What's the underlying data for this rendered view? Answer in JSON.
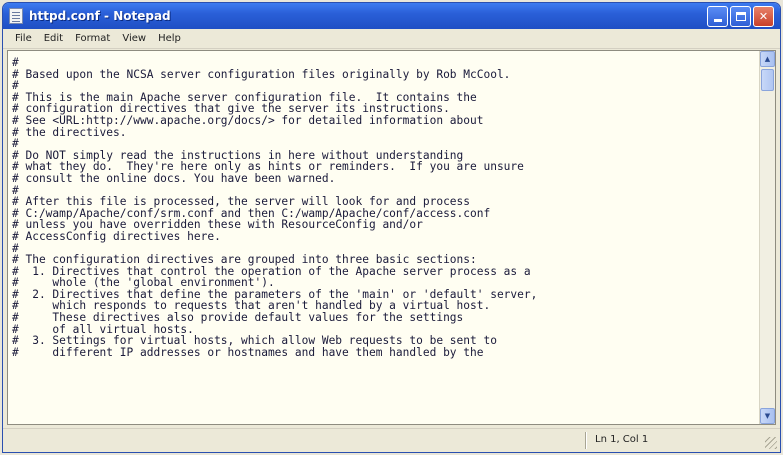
{
  "window": {
    "title": "httpd.conf - Notepad",
    "controls": {
      "minimize": "minimize",
      "maximize": "maximize",
      "close": "✕"
    }
  },
  "menu": {
    "items": [
      "File",
      "Edit",
      "Format",
      "View",
      "Help"
    ]
  },
  "editor": {
    "lines": [
      "#",
      "# Based upon the NCSA server configuration files originally by Rob McCool.",
      "#",
      "# This is the main Apache server configuration file.  It contains the",
      "# configuration directives that give the server its instructions.",
      "# See <URL:http://www.apache.org/docs/> for detailed information about",
      "# the directives.",
      "#",
      "# Do NOT simply read the instructions in here without understanding",
      "# what they do.  They're here only as hints or reminders.  If you are unsure",
      "# consult the online docs. You have been warned.",
      "#",
      "# After this file is processed, the server will look for and process",
      "# C:/wamp/Apache/conf/srm.conf and then C:/wamp/Apache/conf/access.conf",
      "# unless you have overridden these with ResourceConfig and/or",
      "# AccessConfig directives here.",
      "#",
      "# The configuration directives are grouped into three basic sections:",
      "#  1. Directives that control the operation of the Apache server process as a",
      "#     whole (the 'global environment').",
      "#  2. Directives that define the parameters of the 'main' or 'default' server,",
      "#     which responds to requests that aren't handled by a virtual host.",
      "#     These directives also provide default values for the settings",
      "#     of all virtual hosts.",
      "#  3. Settings for virtual hosts, which allow Web requests to be sent to",
      "#     different IP addresses or hostnames and have them handled by the"
    ]
  },
  "statusbar": {
    "position": "Ln 1, Col 1"
  },
  "colors": {
    "titlebar": "#2a5fd8",
    "editor_bg": "#fffef2",
    "text": "#1a1a3a",
    "chrome": "#ece9d8"
  }
}
